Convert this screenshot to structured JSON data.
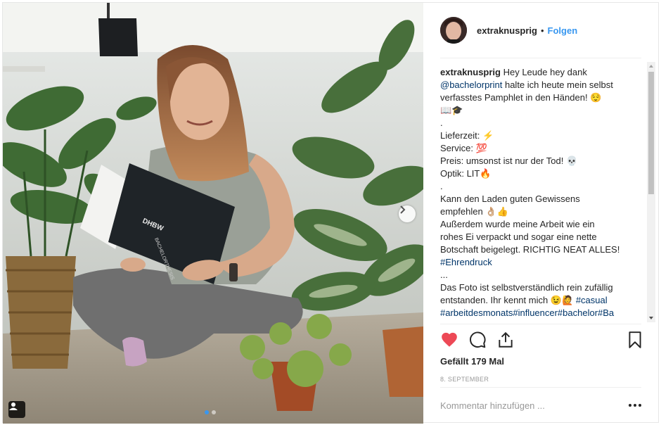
{
  "post": {
    "username": "extraknusprig",
    "separator": "•",
    "follow_label": "Folgen",
    "caption_lines": [
      {
        "parts": [
          {
            "t": "extraknusprig",
            "c": "user"
          },
          {
            "t": " Hey Leude hey dank",
            "c": ""
          }
        ]
      },
      {
        "parts": [
          {
            "t": "@bachelorprint",
            "c": "link"
          },
          {
            "t": " halte ich heute mein selbst",
            "c": ""
          }
        ]
      },
      {
        "parts": [
          {
            "t": "verfasstes Pamphlet in den Händen! 😌",
            "c": ""
          }
        ]
      },
      {
        "parts": [
          {
            "t": "📖🎓",
            "c": ""
          }
        ]
      },
      {
        "parts": [
          {
            "t": ".",
            "c": ""
          }
        ]
      },
      {
        "parts": [
          {
            "t": "Lieferzeit: ⚡",
            "c": ""
          }
        ]
      },
      {
        "parts": [
          {
            "t": "Service: 💯",
            "c": ""
          }
        ]
      },
      {
        "parts": [
          {
            "t": "Preis: umsonst ist nur der Tod! 💀",
            "c": ""
          }
        ]
      },
      {
        "parts": [
          {
            "t": "Optik: LIT🔥",
            "c": ""
          }
        ]
      },
      {
        "parts": [
          {
            "t": ".",
            "c": ""
          }
        ]
      },
      {
        "parts": [
          {
            "t": "Kann den Laden guten Gewissens",
            "c": ""
          }
        ]
      },
      {
        "parts": [
          {
            "t": "empfehlen 👌🏼👍",
            "c": ""
          }
        ]
      },
      {
        "parts": [
          {
            "t": "Außerdem wurde meine Arbeit wie ein",
            "c": ""
          }
        ]
      },
      {
        "parts": [
          {
            "t": "rohes Ei verpackt und sogar eine nette",
            "c": ""
          }
        ]
      },
      {
        "parts": [
          {
            "t": "Botschaft beigelegt. RICHTIG NEAT ALLES!",
            "c": ""
          }
        ]
      },
      {
        "parts": [
          {
            "t": "#Ehrendruck",
            "c": "link"
          }
        ]
      },
      {
        "parts": [
          {
            "t": "...",
            "c": ""
          }
        ]
      },
      {
        "parts": [
          {
            "t": "Das Foto ist selbstverständlich rein zufällig",
            "c": ""
          }
        ]
      },
      {
        "parts": [
          {
            "t": "entstanden. Ihr kennt mich 😉🙋 ",
            "c": ""
          },
          {
            "t": "#casual",
            "c": "link"
          }
        ]
      },
      {
        "parts": [
          {
            "t": "#arbeitdesmonats#influencer#bachelor#Ba",
            "c": "link"
          }
        ]
      }
    ],
    "likes_text": "Gefällt 179 Mal",
    "date_text": "8. SEPTEMBER",
    "comment_placeholder": "Kommentar hinzufügen ...",
    "book_brand": "DHBW",
    "book_title": "BACHELORTHESIS"
  },
  "colors": {
    "link": "#003569",
    "follow": "#3897f0",
    "like_heart": "#ed4956",
    "muted": "#999999"
  },
  "icons": {
    "like": "heart-icon",
    "comment": "comment-icon",
    "share": "share-icon",
    "save": "bookmark-icon",
    "next": "chevron-right-icon",
    "tag": "user-tag-icon",
    "more": "ellipsis-icon"
  }
}
